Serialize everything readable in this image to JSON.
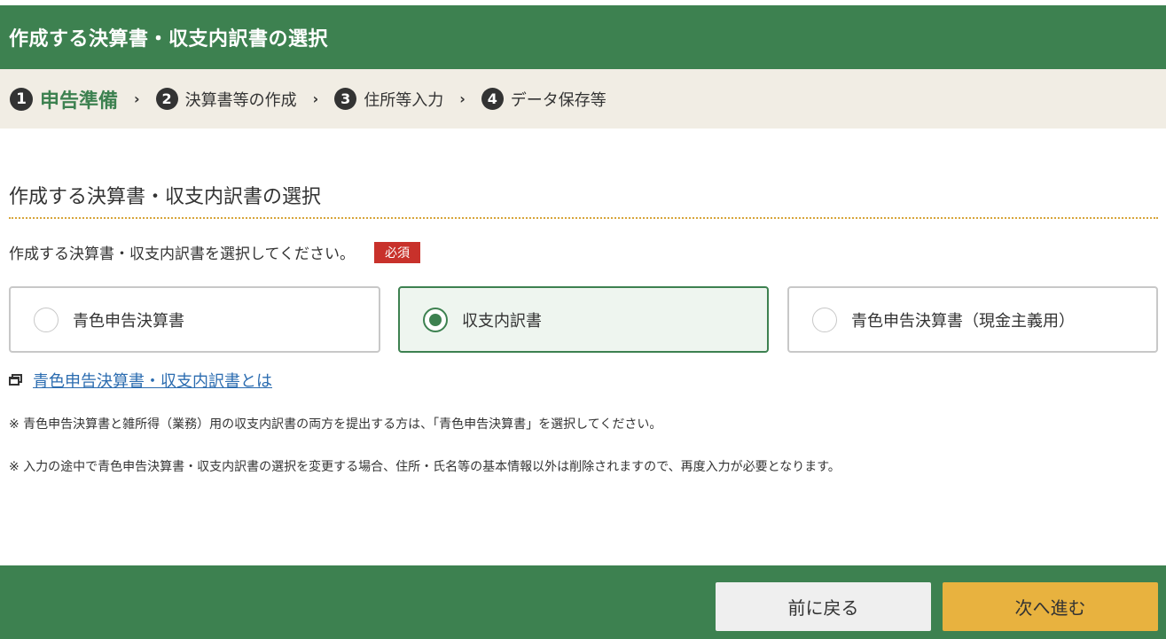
{
  "header": {
    "title": "作成する決算書・収支内訳書の選択"
  },
  "steps": [
    {
      "number": "1",
      "label": "申告準備"
    },
    {
      "number": "2",
      "label": "決算書等の作成"
    },
    {
      "number": "3",
      "label": "住所等入力"
    },
    {
      "number": "4",
      "label": "データ保存等"
    }
  ],
  "step_separator": "›",
  "section": {
    "title": "作成する決算書・収支内訳書の選択"
  },
  "instruction": {
    "text": "作成する決算書・収支内訳書を選択してください。",
    "required_label": "必須"
  },
  "options": [
    {
      "label": "青色申告決算書",
      "selected": false
    },
    {
      "label": "収支内訳書",
      "selected": true
    },
    {
      "label": "青色申告決算書（現金主義用）",
      "selected": false
    }
  ],
  "help_link": {
    "text": "青色申告決算書・収支内訳書とは"
  },
  "notes": [
    "※ 青色申告決算書と雑所得（業務）用の収支内訳書の両方を提出する方は、「青色申告決算書」を選択してください。",
    "※ 入力の途中で青色申告決算書・収支内訳書の選択を変更する場合、住所・氏名等の基本情報以外は削除されますので、再度入力が必要となります。"
  ],
  "footer": {
    "back_label": "前に戻る",
    "next_label": "次へ進む"
  },
  "colors": {
    "header_green": "#3d8150",
    "step_bar_bg": "#f1ede4",
    "required_red": "#c8312b",
    "next_button": "#e8b23f",
    "back_button": "#efefef",
    "link_blue": "#2b6cb0"
  }
}
